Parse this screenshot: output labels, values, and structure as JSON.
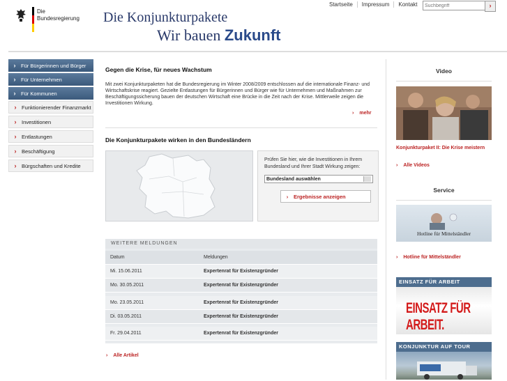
{
  "header": {
    "logo_line1": "Die",
    "logo_line2": "Bundesregierung",
    "title_line1": "Die Konjunkturpakete",
    "title_line2_a": "Wir bauen",
    "title_line2_b": "Zukunft",
    "top_links": [
      "Startseite",
      "Impressum",
      "Kontakt"
    ],
    "search_placeholder": "Suchbegriff",
    "search_button": "›"
  },
  "sidebar": {
    "items": [
      {
        "label": "Für Bürgerinnen und Bürger",
        "style": "dark"
      },
      {
        "label": "Für Unternehmen",
        "style": "dark"
      },
      {
        "label": "Für Kommunen",
        "style": "dark"
      },
      {
        "label": "Funktionierender Finanzmarkt",
        "style": "light"
      },
      {
        "label": "Investitionen",
        "style": "light"
      },
      {
        "label": "Entlastungen",
        "style": "light"
      },
      {
        "label": "Beschäftigung",
        "style": "light"
      },
      {
        "label": "Bürgschaften und Kredite",
        "style": "light"
      }
    ]
  },
  "main": {
    "intro_title": "Gegen die Krise, für neues Wachstum",
    "intro_text": "Mit zwei Konjunkturpaketen hat die Bundesregierung im Winter 2008/2009 entschlossen auf die internationale Finanz- und Wirtschaftskrise reagiert. Gezielte Entlastungen für Bürgerinnen und Bürger wie für Unternehmen und Maßnahmen zur Beschäftigungssicherung bauen der deutschen Wirtschaft eine Brücke in die Zeit nach der Krise. Mittlerweile zeigen die Investitionen Wirkung.",
    "more_label": "mehr",
    "laender_title": "Die Konjunkturpakete wirken in den Bundesländern",
    "form_text": "Prüfen Sie hier, wie die Investitionen in Ihrem Bundesland und Ihrer Stadt Wirkung zeigen:",
    "select_value": "Bundesland auswählen",
    "result_button": "Ergebnisse anzeigen",
    "news": {
      "heading": "WEITERE MELDUNGEN",
      "col_date": "Datum",
      "col_msg": "Meldungen",
      "rows": [
        {
          "date": "Mi. 15.06.2011",
          "msg": "Expertenrat für Existenzgründer"
        },
        {
          "date": "Mo. 30.05.2011",
          "msg": "Expertenrat für Existenzgründer"
        },
        {
          "date": "Mo. 23.05.2011",
          "msg": "Expertenrat für Existenzgründer"
        },
        {
          "date": "Di. 03.05.2011",
          "msg": "Expertenrat für Existenzgründer"
        },
        {
          "date": "Fr. 29.04.2011",
          "msg": "Expertenrat für Existenzgründer"
        }
      ],
      "all_label": "Alle Artikel"
    }
  },
  "right": {
    "video_title": "Video",
    "video_caption": "Konjunkturpaket II: Die Krise meistern",
    "all_videos": "Alle Videos",
    "service_title": "Service",
    "service_caption": "Hotline für Mittelständler",
    "service_link": "Hotline für Mittelständler",
    "einsatz_bar": "EINSATZ FÜR ARBEIT",
    "einsatz_text": "EINSATZ FÜR ARBEIT.",
    "tour_bar": "KONJUNKTUR AUF TOUR"
  },
  "colors": {
    "accent_red": "#b22222",
    "nav_blue": "#4a6a8c",
    "title_blue": "#2a3a6a"
  }
}
